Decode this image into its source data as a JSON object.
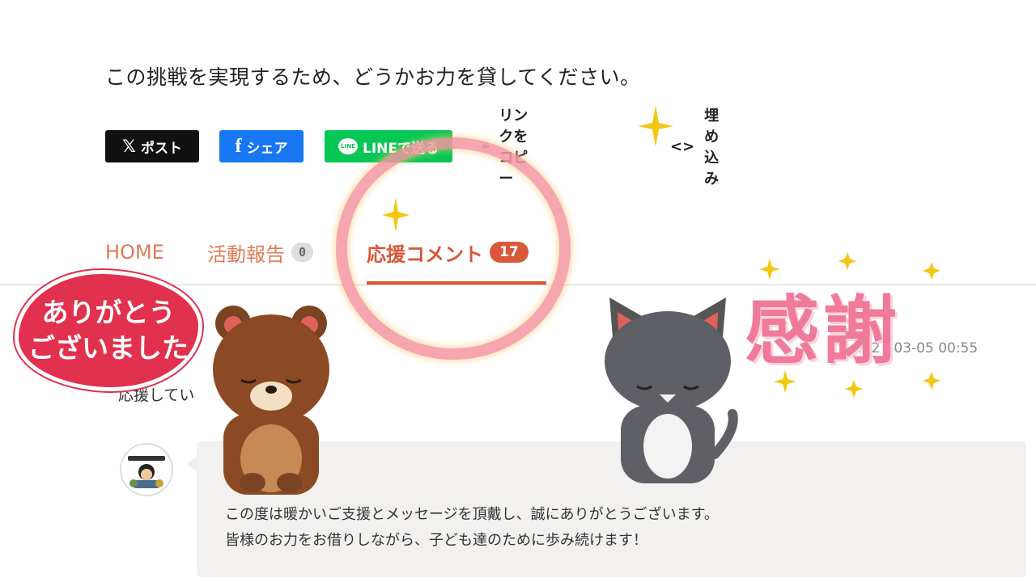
{
  "intro_text": "この挑戦を実現するため、どうかお力を貸してください。",
  "share": {
    "x_label": "ポスト",
    "x_icon": "𝕏",
    "facebook_label": "シェア",
    "facebook_icon": "f",
    "line_label": "LINEで送る",
    "line_icon_text": "LINE",
    "copy_link_label": "リンクをコピー",
    "embed_label": "埋め込み",
    "embed_icon": "<>"
  },
  "tabs": [
    {
      "label": "HOME"
    },
    {
      "label": "活動報告",
      "count": "0"
    },
    {
      "label": "応援コメント",
      "count": "17",
      "active": true
    }
  ],
  "comment": {
    "date_visible": "2025-03-05 00:55",
    "text_visible": "応援してい"
  },
  "reply": {
    "line1": "この度は暖かいご支援とメッセージを頂戴し、誠にありがとうございます。",
    "line2": "皆様のお力をお借りしながら、子ども達のために歩み続けます！"
  },
  "stickers": {
    "thanks_line1": "ありがとう",
    "thanks_line2": "ございました",
    "kansha": "感謝"
  },
  "colors": {
    "accent": "#d9573a",
    "tab_text": "#e07a5c",
    "x_bg": "#111111",
    "facebook_bg": "#1877f2",
    "line_bg": "#06c755",
    "sticker_red": "#e1314e",
    "kansha_pink": "#f07a9a"
  },
  "icons": {
    "link": "link-icon",
    "embed": "code-brackets-icon",
    "bear": "bowing-bear-illustration",
    "cat": "bowing-cat-illustration"
  }
}
